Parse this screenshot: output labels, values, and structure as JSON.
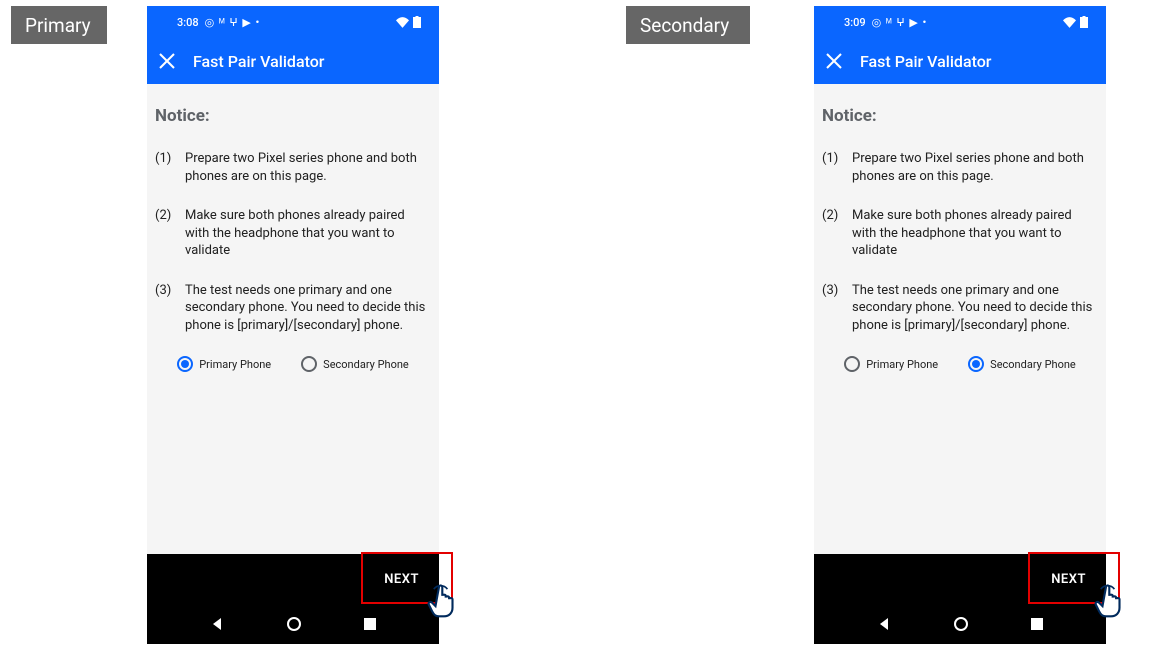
{
  "labels": {
    "primary": "Primary",
    "secondary": "Secondary"
  },
  "colors": {
    "brand": "#0a66ff",
    "highlight": "#e30000",
    "label_bg": "#666666"
  },
  "phones": [
    {
      "id": "primary",
      "status_time": "3:08",
      "app_title": "Fast Pair Validator",
      "notice_title": "Notice:",
      "notice_items": [
        {
          "num": "(1)",
          "text": "Prepare two Pixel series phone and both phones are on this page."
        },
        {
          "num": "(2)",
          "text": "Make sure both phones already paired with the headphone that you want to validate"
        },
        {
          "num": "(3)",
          "text": "The test needs one primary and one secondary phone. You need to decide this phone is [primary]/[secondary] phone."
        }
      ],
      "radio": {
        "primary_label": "Primary Phone",
        "secondary_label": "Secondary Phone",
        "selected": "primary"
      },
      "next_label": "NEXT"
    },
    {
      "id": "secondary",
      "status_time": "3:09",
      "app_title": "Fast Pair Validator",
      "notice_title": "Notice:",
      "notice_items": [
        {
          "num": "(1)",
          "text": "Prepare two Pixel series phone and both phones are on this page."
        },
        {
          "num": "(2)",
          "text": "Make sure both phones already paired with the headphone that you want to validate"
        },
        {
          "num": "(3)",
          "text": "The test needs one primary and one secondary phone. You need to decide this phone is [primary]/[secondary] phone."
        }
      ],
      "radio": {
        "primary_label": "Primary Phone",
        "secondary_label": "Secondary Phone",
        "selected": "secondary"
      },
      "next_label": "NEXT"
    }
  ],
  "status_icons_text": "◎ ᴹ ⵖ ▶ •",
  "status_right_text": "▾ ▮"
}
